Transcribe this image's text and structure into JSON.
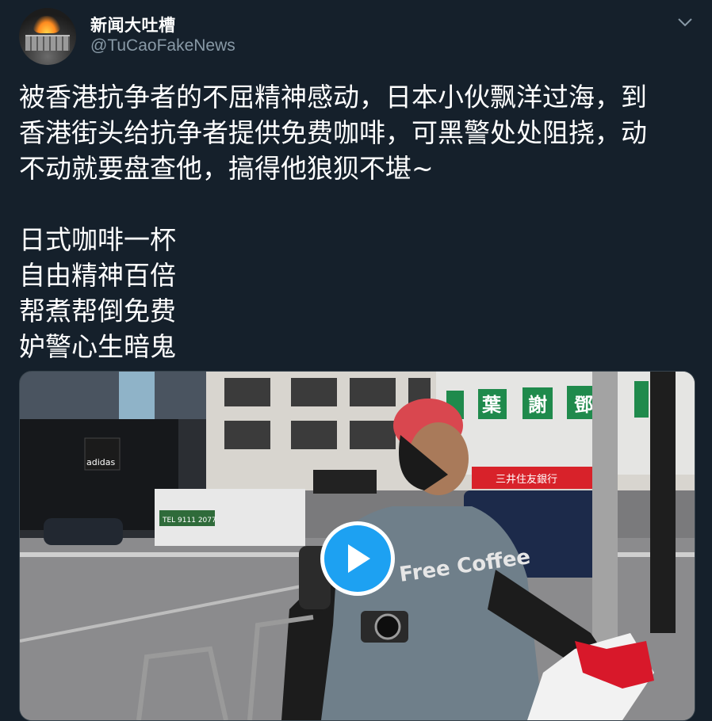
{
  "tweet": {
    "display_name": "新闻大吐槽",
    "handle": "@TuCaoFakeNews",
    "text": "被香港抗争者的不屈精神感动，日本小伙飘洋过海，到\n香港街头给抗争者提供免费咖啡，可黑警处处阻挠，动\n不动就要盘查他，搞得他狼狈不堪~\n\n日式咖啡一杯\n自由精神百倍\n帮煮帮倒免费\n妒警心生暗鬼"
  },
  "icons": {
    "menu": "chevron-down-icon",
    "play": "play-icon",
    "avatar": "great-wall-on-fire"
  },
  "video": {
    "signs": [
      "adidas",
      "葉",
      "謝",
      "鄧",
      "三井住友銀行",
      "TEL 9111 2077"
    ],
    "shirt_text": "Free Coffee"
  },
  "colors": {
    "background": "#15202b",
    "text": "#ffffff",
    "secondary_text": "#8899a6",
    "accent": "#1da1f2"
  }
}
